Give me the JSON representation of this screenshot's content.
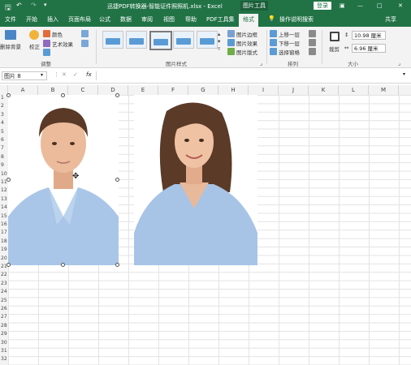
{
  "titlebar": {
    "title": "迅捷PDF转换器-智能证件照照机.xlsx  -  Excel",
    "context_tool": "图片工具",
    "login": "登录",
    "window_controls": [
      "—",
      "□",
      "✕"
    ]
  },
  "ribbon_tabs": [
    "文件",
    "开始",
    "插入",
    "页面布局",
    "公式",
    "数据",
    "审阅",
    "视图",
    "帮助",
    "PDF工具集",
    "格式"
  ],
  "active_tab": "格式",
  "tell_me": "操作说明搜索",
  "share": "共享",
  "ribbon": {
    "remove_bg": "删除背景",
    "correct": "校正",
    "color": "颜色",
    "art_effects": "艺术效果",
    "adjust_group": "调整",
    "styles_group": "图片样式",
    "border": "图片边框",
    "effects": "图片效果",
    "layout": "图片版式",
    "bring_forward": "上移一层",
    "send_backward": "下移一层",
    "selection_pane": "选择窗格",
    "arrange_group": "排列",
    "crop": "裁剪",
    "height": "10.98 厘米",
    "width": "6.96 厘米",
    "size_group": "大小"
  },
  "formula_bar": {
    "name_box": "图片 8",
    "fx": "fx",
    "content": ""
  },
  "columns": [
    "A",
    "B",
    "C",
    "D",
    "E",
    "F",
    "G",
    "H",
    "I",
    "J",
    "K",
    "L",
    "M"
  ],
  "rows": [
    "1",
    "2",
    "3",
    "4",
    "5",
    "6",
    "7",
    "8",
    "9",
    "10",
    "11",
    "12",
    "13",
    "14",
    "15",
    "16",
    "17",
    "18",
    "19",
    "20",
    "21",
    "22",
    "23",
    "24",
    "25",
    "26",
    "27",
    "28",
    "29",
    "30",
    "31",
    "32"
  ],
  "colors": {
    "excel_green": "#217346",
    "shirt": "#a7c4e6",
    "skin": "#e8b99a"
  }
}
